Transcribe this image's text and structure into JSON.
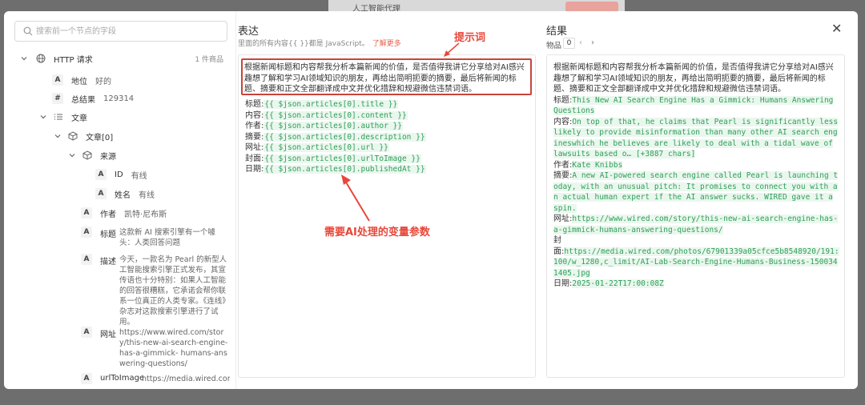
{
  "background": {
    "title": "人工智能代理"
  },
  "left": {
    "search_placeholder": "搜索前一个节点的字段",
    "root": {
      "label": "HTTP 请求",
      "count": "1 件商品"
    },
    "fields": {
      "status": {
        "type": "A",
        "label": "地位",
        "value": "好的"
      },
      "total": {
        "type": "#",
        "label": "总结果",
        "value": "129314"
      },
      "articles": {
        "label": "文章"
      },
      "article0": {
        "label": "文章[0]"
      },
      "source": {
        "label": "来源"
      },
      "source_id": {
        "type": "A",
        "label": "ID",
        "value": "有线"
      },
      "source_name": {
        "type": "A",
        "label": "姓名",
        "value": "有线"
      },
      "author": {
        "type": "A",
        "label": "作者",
        "value": "凯特·尼布斯"
      },
      "title": {
        "type": "A",
        "label": "标题",
        "value": "这款新 AI 搜索引擎有一个噱头：人类回答问题"
      },
      "description": {
        "type": "A",
        "label": "描述",
        "value": "今天，一款名为 Pearl 的新型人工智能搜索引擎正式发布，其宣传语也十分特别：如果人工智能的回答很糟糕，它承诺会帮你联系一位真正的人类专家。《连线》杂志对这款搜索引擎进行了试用。"
      },
      "url": {
        "type": "A",
        "label": "网址",
        "value": "https://www.wired.com/story/this-new-ai-search-engine-has-a-gimmick- humans-answering-questions/"
      },
      "cut": {
        "type": "A",
        "label": "urlToImage",
        "value": "https://media.wired.com/photos"
      }
    }
  },
  "middle": {
    "title": "表达",
    "subtitle": "里面的所有内容{{ }}都是 JavaScript。",
    "learn_more": "了解更多",
    "prompt": "根据新闻标题和内容帮我分析本篇新闻的价值，是否值得我讲它分享给对AI感兴趣想了解和学习AI领域知识的朋友，再给出简明扼要的摘要，最后将新闻的标题、摘要和正文全部翻译成中文并优化措辞和规避微信违禁词语。",
    "vars": [
      {
        "label": "标题:",
        "code": "{{ $json.articles[0].title }}"
      },
      {
        "label": "内容:",
        "code": "{{ $json.articles[0].content }}"
      },
      {
        "label": "作者:",
        "code": "{{ $json.articles[0].author }}"
      },
      {
        "label": "摘要:",
        "code": "{{ $json.articles[0].description }}"
      },
      {
        "label": "网址:",
        "code": "{{ $json.articles[0].url }}"
      },
      {
        "label": "封面:",
        "code": "{{ $json.articles[0].urlToImage }}"
      },
      {
        "label": "日期:",
        "code": "{{ $json.articles[0].publishedAt }}"
      }
    ],
    "annotation_prompt": "提示词",
    "annotation_vars": "需要AI处理的变量参数"
  },
  "right": {
    "title": "结果",
    "items_label": "物品",
    "items_count": "0",
    "prompt": "根据新闻标题和内容帮我分析本篇新闻的价值，是否值得我讲它分享给对AI感兴趣想了解和学习AI领域知识的朋友，再给出简明扼要的摘要，最后将新闻的标题、摘要和正文全部翻译成中文并优化措辞和规避微信违禁词语。",
    "rows": [
      {
        "label": "标题:",
        "value": "This New AI Search Engine Has a Gimmick: Humans Answering Questions"
      },
      {
        "label": "内容:",
        "value": "On top of that, he claims that Pearl is significantly less likely to provide misinformation than many other AI search engineswhich he believes are likely to deal with a tidal wave of lawsuits based o… [+3887 chars]"
      },
      {
        "label": "作者:",
        "value": "Kate Knibbs"
      },
      {
        "label": "摘要:",
        "value": "A new AI-powered search engine called Pearl is launching today, with an unusual pitch: It promises to connect you with an actual human expert if the AI answer sucks. WIRED gave it a spin."
      },
      {
        "label": "网址:",
        "value": "https://www.wired.com/story/this-new-ai-search-engine-has-a-gimmick-humans-answering-questions/"
      },
      {
        "label": "封\n面:",
        "value": "https://media.wired.com/photos/67901339a05cfce5b8548920/191:100/w_1280,c_limit/AI-Lab-Search-Engine-Humans-Business-1500341405.jpg"
      },
      {
        "label": "日期:",
        "value": "2025-01-22T17:00:08Z"
      }
    ]
  },
  "colors": {
    "accent": "#e8614c",
    "annotation": "#e8473a",
    "code": "#2e9e58",
    "code_bg": "#eaf7ee"
  }
}
